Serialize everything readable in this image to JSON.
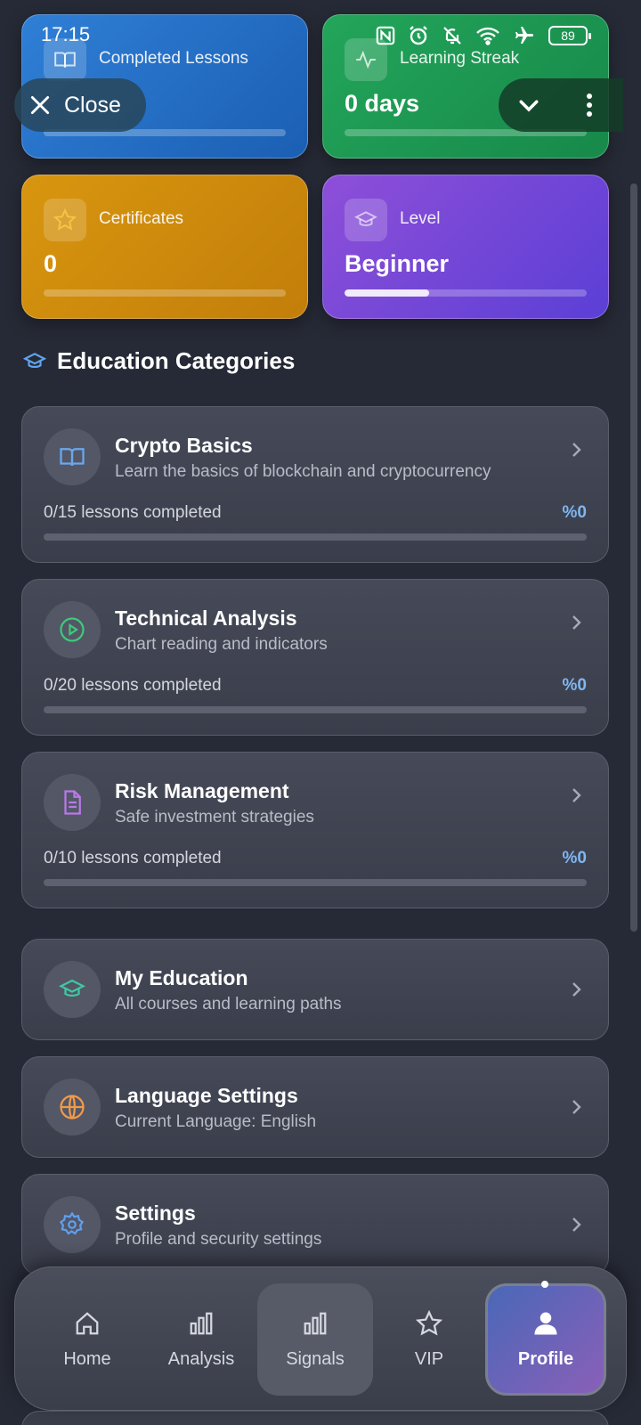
{
  "status_bar": {
    "time": "17:15",
    "battery": "89"
  },
  "overlay": {
    "close_label": "Close"
  },
  "stats": [
    {
      "label": "Completed Lessons",
      "value": "",
      "progress": 0
    },
    {
      "label": "Learning Streak",
      "value": "0 days",
      "progress": 0
    },
    {
      "label": "Certificates",
      "value": "0",
      "progress": 0
    },
    {
      "label": "Level",
      "value": "Beginner",
      "progress": 0.35
    }
  ],
  "section": {
    "title": "Education Categories"
  },
  "categories": [
    {
      "title": "Crypto Basics",
      "subtitle": "Learn the basics of blockchain and cryptocurrency",
      "progress_text": "0/15 lessons completed",
      "percent": "%0",
      "progress": 0,
      "icon": "book-icon"
    },
    {
      "title": "Technical Analysis",
      "subtitle": "Chart reading and indicators",
      "progress_text": "0/20 lessons completed",
      "percent": "%0",
      "progress": 0,
      "icon": "play-circle-icon"
    },
    {
      "title": "Risk Management",
      "subtitle": "Safe investment strategies",
      "progress_text": "0/10 lessons completed",
      "percent": "%0",
      "progress": 0,
      "icon": "document-icon"
    }
  ],
  "menu": [
    {
      "title": "My Education",
      "subtitle": "All courses and learning paths",
      "icon": "graduation-cap-icon"
    },
    {
      "title": "Language Settings",
      "subtitle": "Current Language: English",
      "icon": "globe-icon"
    },
    {
      "title": "Settings",
      "subtitle": "Profile and security settings",
      "icon": "gear-icon"
    }
  ],
  "nav": {
    "home": "Home",
    "analysis": "Analysis",
    "signals": "Signals",
    "vip": "VIP",
    "profile": "Profile",
    "active": "profile"
  },
  "colors": {
    "accent_blue": "#7fb6f2",
    "completed_card": "#2f7fd6",
    "streak_card": "#23a55a",
    "certificates_card": "#d8960f",
    "level_card": "#8e4fd8"
  }
}
